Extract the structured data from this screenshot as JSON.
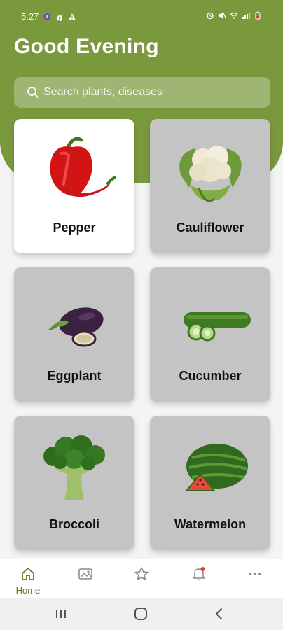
{
  "status_bar": {
    "time": "5:27"
  },
  "header": {
    "greeting": "Good Evening"
  },
  "search": {
    "placeholder": "Search plants, diseases"
  },
  "plants": [
    {
      "name": "Pepper",
      "selected": true
    },
    {
      "name": "Cauliflower",
      "selected": false
    },
    {
      "name": "Eggplant",
      "selected": false
    },
    {
      "name": "Cucumber",
      "selected": false
    },
    {
      "name": "Broccoli",
      "selected": false
    },
    {
      "name": "Watermelon",
      "selected": false
    }
  ],
  "bottom_nav": {
    "home_label": "Home",
    "items": [
      "home-icon",
      "gallery-icon",
      "star-icon",
      "bell-icon",
      "more-icon"
    ]
  },
  "colors": {
    "brand": "#7a993d",
    "card": "#c4c4c4",
    "active_card": "#ffffff",
    "notification": "#e53935"
  }
}
